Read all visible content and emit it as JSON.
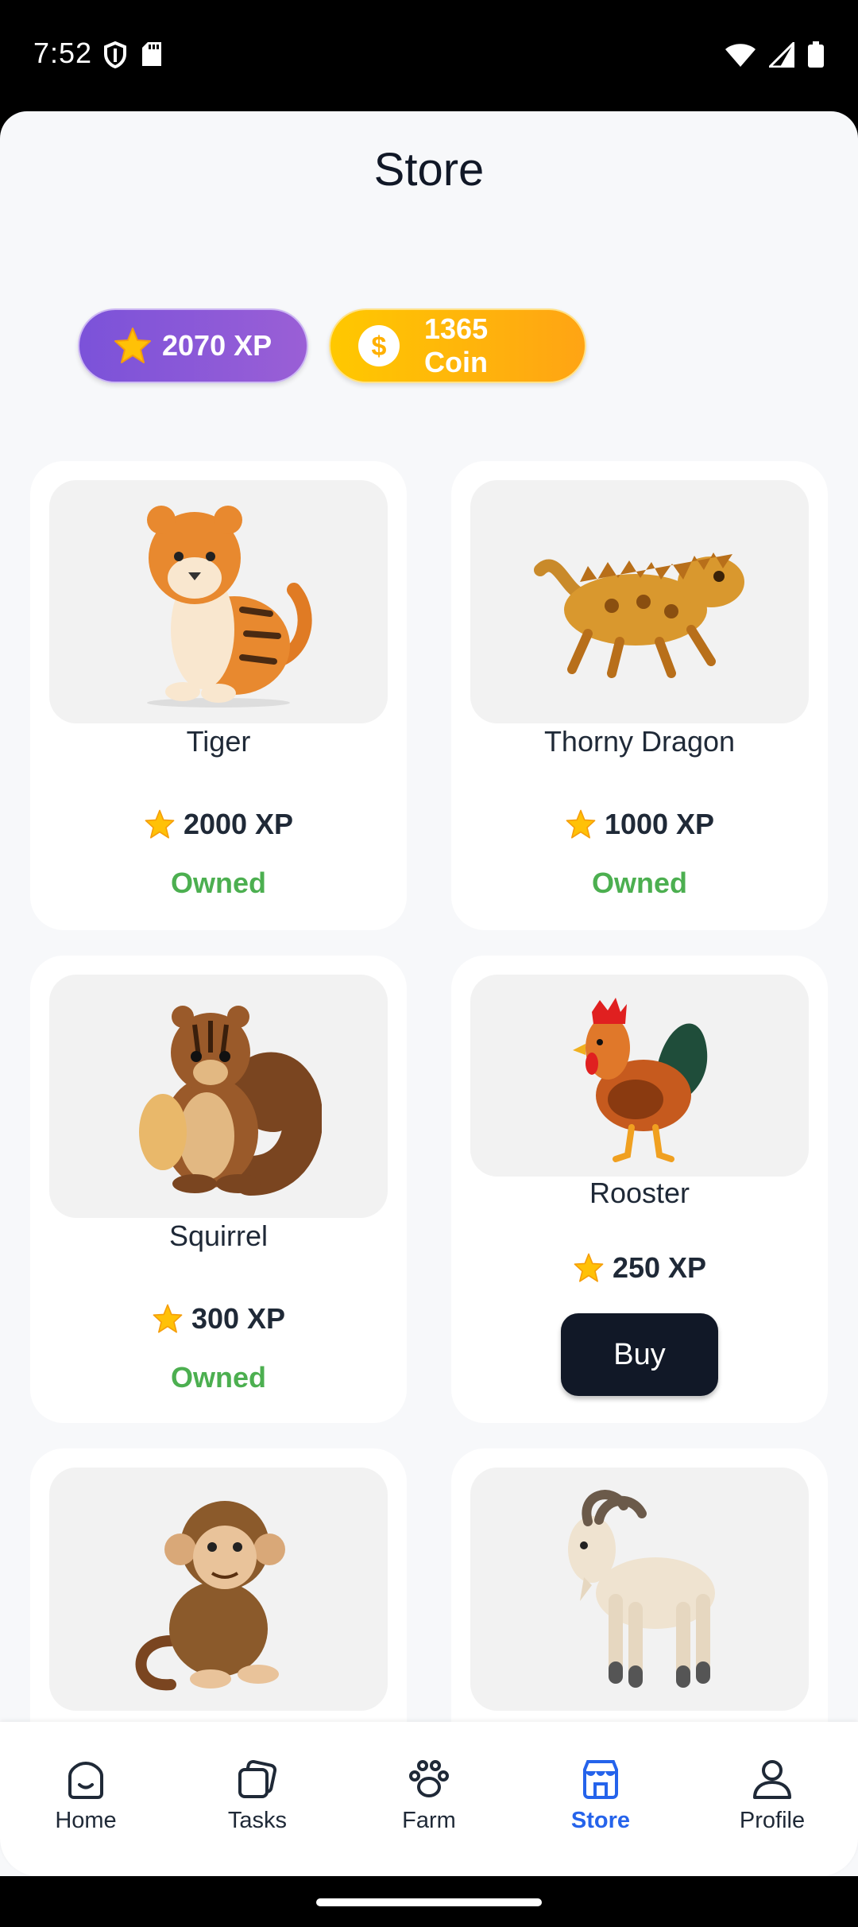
{
  "status_bar": {
    "time": "7:52"
  },
  "page": {
    "title": "Store"
  },
  "balances": {
    "xp": "2070 XP",
    "coin": "1365 Coin"
  },
  "items": [
    {
      "name": "Tiger",
      "price": "2000 XP",
      "status": "Owned",
      "icon": "tiger-icon"
    },
    {
      "name": "Thorny Dragon",
      "price": "1000 XP",
      "status": "Owned",
      "icon": "thorny-dragon-icon"
    },
    {
      "name": "Squirrel",
      "price": "300 XP",
      "status": "Owned",
      "icon": "squirrel-icon"
    },
    {
      "name": "Rooster",
      "price": "250 XP",
      "action": "Buy",
      "icon": "rooster-icon"
    },
    {
      "icon": "monkey-icon"
    },
    {
      "icon": "goat-icon"
    }
  ],
  "nav": [
    {
      "label": "Home",
      "icon": "home-icon"
    },
    {
      "label": "Tasks",
      "icon": "tasks-icon"
    },
    {
      "label": "Farm",
      "icon": "paw-icon"
    },
    {
      "label": "Store",
      "icon": "store-icon",
      "active": true
    },
    {
      "label": "Profile",
      "icon": "profile-icon"
    }
  ],
  "colors": {
    "xp_pill": "#7b52d9",
    "coin_pill": "#ffb000",
    "owned": "#4caf50",
    "active_nav": "#2563eb",
    "buy_button": "#111827"
  }
}
